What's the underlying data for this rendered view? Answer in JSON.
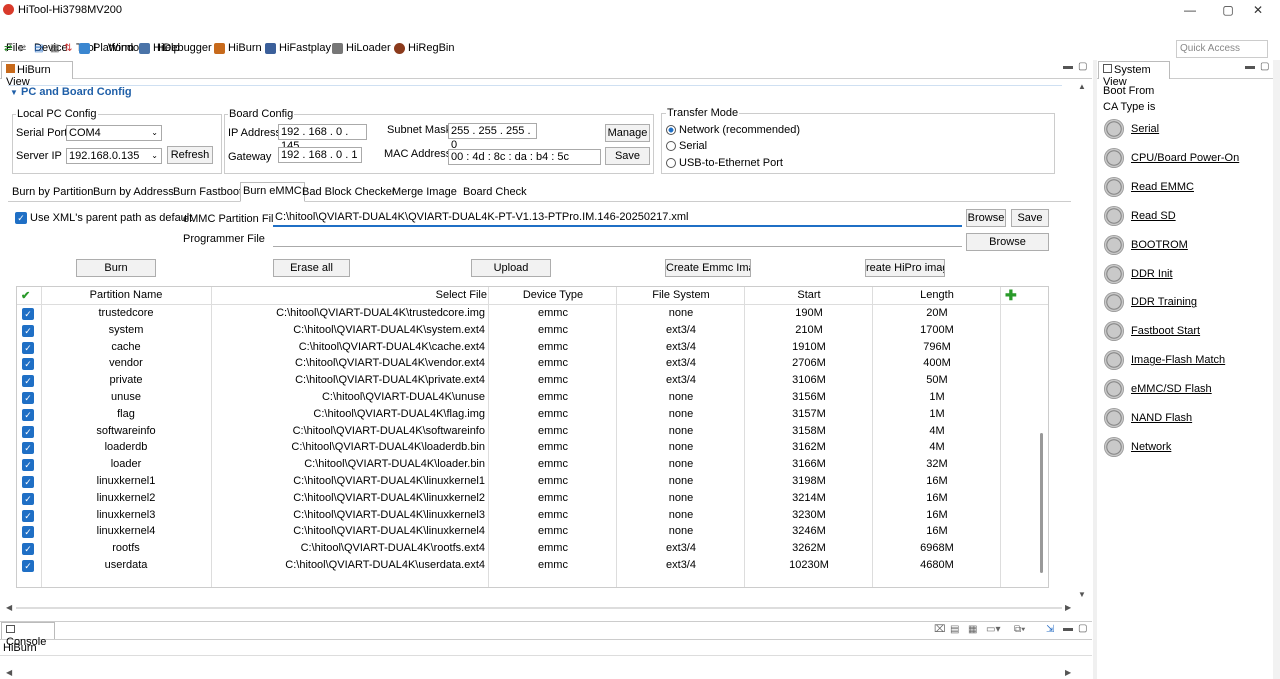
{
  "window": {
    "title": "HiTool-Hi3798MV200",
    "min": "—",
    "max": "▢",
    "close": "✕"
  },
  "menu": [
    "File",
    "Device",
    "Tool",
    "Window",
    "Help"
  ],
  "toolbar": {
    "items": [
      "Platform",
      "HiDebugger",
      "HiBurn",
      "HiFastplay",
      "HiLoader",
      "HiRegBin"
    ],
    "quick_access": "Quick Access"
  },
  "hiburn_view": {
    "title": "HiBurn View"
  },
  "pc_board": {
    "section_title": "PC and Board Config",
    "local_pc": {
      "title": "Local PC Config",
      "serial_port_label": "Serial Port",
      "serial_port_value": "COM4",
      "server_ip_label": "Server IP",
      "server_ip_value": "192.168.0.135",
      "refresh": "Refresh"
    },
    "board": {
      "title": "Board Config",
      "ip_label": "IP Address",
      "ip_value": "192 . 168 . 0 . 145",
      "subnet_label": "Subnet Mask",
      "subnet_value": "255 . 255 . 255 . 0",
      "manage": "Manage",
      "gateway_label": "Gateway",
      "gateway_value": "192 . 168 . 0 . 1",
      "mac_label": "MAC Address",
      "mac_value": "00 : 4d : 8c : da : b4 : 5c",
      "save": "Save"
    },
    "transfer": {
      "title": "Transfer Mode",
      "options": [
        "Network (recommended)",
        "Serial",
        "USB-to-Ethernet Port"
      ],
      "selected": 0
    }
  },
  "tabs": [
    "Burn by Partition",
    "Burn by Address",
    "Burn Fastboot",
    "Burn eMMC",
    "Bad Block Checker",
    "Merge Image",
    "Board Check"
  ],
  "active_tab": "Burn eMMC",
  "emmc": {
    "use_xml_label": "Use XML's parent path as default",
    "partition_file_label": "eMMC Partition File",
    "partition_file_value": "C:\\hitool\\QVIART-DUAL4K\\QVIART-DUAL4K-PT-V1.13-PTPro.IM.146-20250217.xml",
    "browse": "Browse",
    "save": "Save",
    "programmer_label": "Programmer File",
    "programmer_value": "",
    "browse2": "Browse",
    "buttons": {
      "burn": "Burn",
      "erase": "Erase all",
      "upload": "Upload",
      "create_emmc": "Create Emmc Image",
      "create_hipro": "reate HiPro imag"
    }
  },
  "table": {
    "headers": [
      "Partition Name",
      "Select File",
      "Device Type",
      "File System",
      "Start",
      "Length"
    ],
    "rows": [
      [
        "trustedcore",
        "C:\\hitool\\QVIART-DUAL4K\\trustedcore.img",
        "emmc",
        "none",
        "190M",
        "20M"
      ],
      [
        "system",
        "C:\\hitool\\QVIART-DUAL4K\\system.ext4",
        "emmc",
        "ext3/4",
        "210M",
        "1700M"
      ],
      [
        "cache",
        "C:\\hitool\\QVIART-DUAL4K\\cache.ext4",
        "emmc",
        "ext3/4",
        "1910M",
        "796M"
      ],
      [
        "vendor",
        "C:\\hitool\\QVIART-DUAL4K\\vendor.ext4",
        "emmc",
        "ext3/4",
        "2706M",
        "400M"
      ],
      [
        "private",
        "C:\\hitool\\QVIART-DUAL4K\\private.ext4",
        "emmc",
        "ext3/4",
        "3106M",
        "50M"
      ],
      [
        "unuse",
        "C:\\hitool\\QVIART-DUAL4K\\unuse",
        "emmc",
        "none",
        "3156M",
        "1M"
      ],
      [
        "flag",
        "C:\\hitool\\QVIART-DUAL4K\\flag.img",
        "emmc",
        "none",
        "3157M",
        "1M"
      ],
      [
        "softwareinfo",
        "C:\\hitool\\QVIART-DUAL4K\\softwareinfo",
        "emmc",
        "none",
        "3158M",
        "4M"
      ],
      [
        "loaderdb",
        "C:\\hitool\\QVIART-DUAL4K\\loaderdb.bin",
        "emmc",
        "none",
        "3162M",
        "4M"
      ],
      [
        "loader",
        "C:\\hitool\\QVIART-DUAL4K\\loader.bin",
        "emmc",
        "none",
        "3166M",
        "32M"
      ],
      [
        "linuxkernel1",
        "C:\\hitool\\QVIART-DUAL4K\\linuxkernel1",
        "emmc",
        "none",
        "3198M",
        "16M"
      ],
      [
        "linuxkernel2",
        "C:\\hitool\\QVIART-DUAL4K\\linuxkernel2",
        "emmc",
        "none",
        "3214M",
        "16M"
      ],
      [
        "linuxkernel3",
        "C:\\hitool\\QVIART-DUAL4K\\linuxkernel3",
        "emmc",
        "none",
        "3230M",
        "16M"
      ],
      [
        "linuxkernel4",
        "C:\\hitool\\QVIART-DUAL4K\\linuxkernel4",
        "emmc",
        "none",
        "3246M",
        "16M"
      ],
      [
        "rootfs",
        "C:\\hitool\\QVIART-DUAL4K\\rootfs.ext4",
        "emmc",
        "ext3/4",
        "3262M",
        "6968M"
      ],
      [
        "userdata",
        "C:\\hitool\\QVIART-DUAL4K\\userdata.ext4",
        "emmc",
        "ext3/4",
        "10230M",
        "4680M"
      ]
    ]
  },
  "console": {
    "title": "Console",
    "text": "HiBurn"
  },
  "system_view": {
    "title": "System View",
    "boot_from": "Boot From",
    "ca_type": "CA Type is",
    "items": [
      "Serial",
      "CPU/Board Power-On",
      "Read EMMC",
      "Read SD",
      "BOOTROM",
      "DDR Init",
      "DDR Training",
      "Fastboot Start",
      "Image-Flash Match",
      "eMMC/SD Flash",
      "NAND Flash",
      "Network"
    ]
  },
  "colors": {
    "accent": "#1f6fc5",
    "section_title": "#1f5fa8"
  }
}
